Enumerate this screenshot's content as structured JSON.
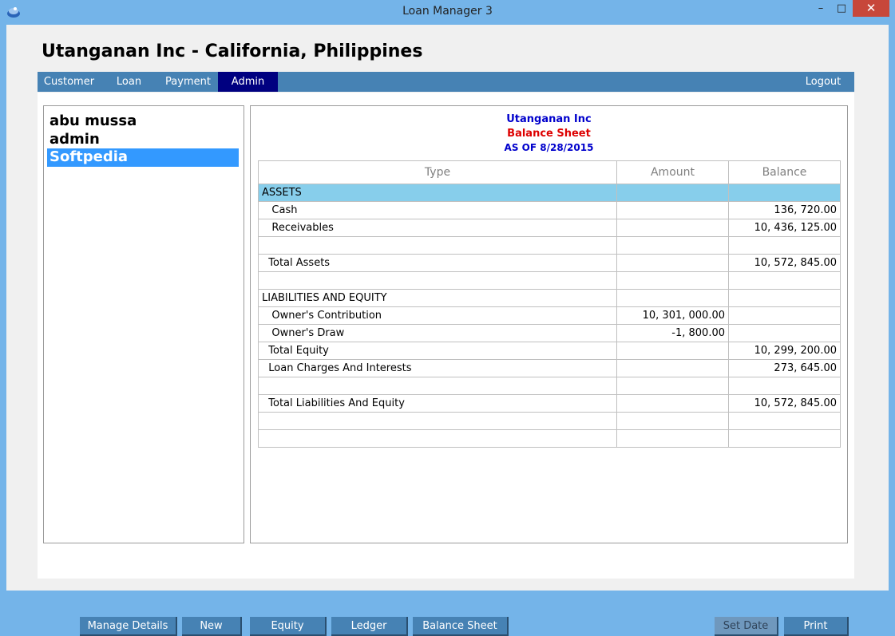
{
  "window": {
    "title": "Loan Manager 3",
    "minimize": "–",
    "maximize": "□",
    "close": "✕"
  },
  "header": {
    "company": "Utanganan Inc - California, Philippines"
  },
  "nav": {
    "customer": "Customer",
    "loan": "Loan",
    "payment": "Payment",
    "admin": "Admin",
    "logout": "Logout"
  },
  "users": [
    "abu mussa",
    "admin",
    "Softpedia"
  ],
  "report": {
    "company": "Utanganan Inc",
    "title": "Balance Sheet",
    "date": "AS OF 8/28/2015",
    "columns": [
      "Type",
      "Amount",
      "Balance"
    ],
    "rows": [
      [
        "ASSETS",
        "",
        ""
      ],
      [
        "   Cash",
        "",
        "136, 720.00"
      ],
      [
        "   Receivables",
        "",
        "10, 436, 125.00"
      ],
      [
        "",
        "",
        ""
      ],
      [
        "  Total Assets",
        "",
        "10, 572, 845.00"
      ],
      [
        "",
        "",
        ""
      ],
      [
        "LIABILITIES AND EQUITY",
        "",
        ""
      ],
      [
        "   Owner's Contribution",
        "10, 301, 000.00",
        ""
      ],
      [
        "   Owner's Draw",
        "-1, 800.00",
        ""
      ],
      [
        "  Total Equity",
        "",
        "10, 299, 200.00"
      ],
      [
        "  Loan Charges And Interests",
        "",
        "273, 645.00"
      ],
      [
        "",
        "",
        ""
      ],
      [
        "  Total Liabilities And Equity",
        "",
        "10, 572, 845.00"
      ],
      [
        "",
        "",
        ""
      ],
      [
        "",
        "",
        ""
      ]
    ]
  },
  "buttons": {
    "manage_details": "Manage Details",
    "new": "New",
    "equity": "Equity",
    "ledger": "Ledger",
    "balance_sheet": "Balance Sheet",
    "set_date": "Set Date",
    "print": "Print"
  },
  "colors": {
    "window": "#74b4e9",
    "nav": "#4682b4",
    "nav_active": "#000080",
    "selected": "#3399ff",
    "section": "#87ceeb"
  }
}
